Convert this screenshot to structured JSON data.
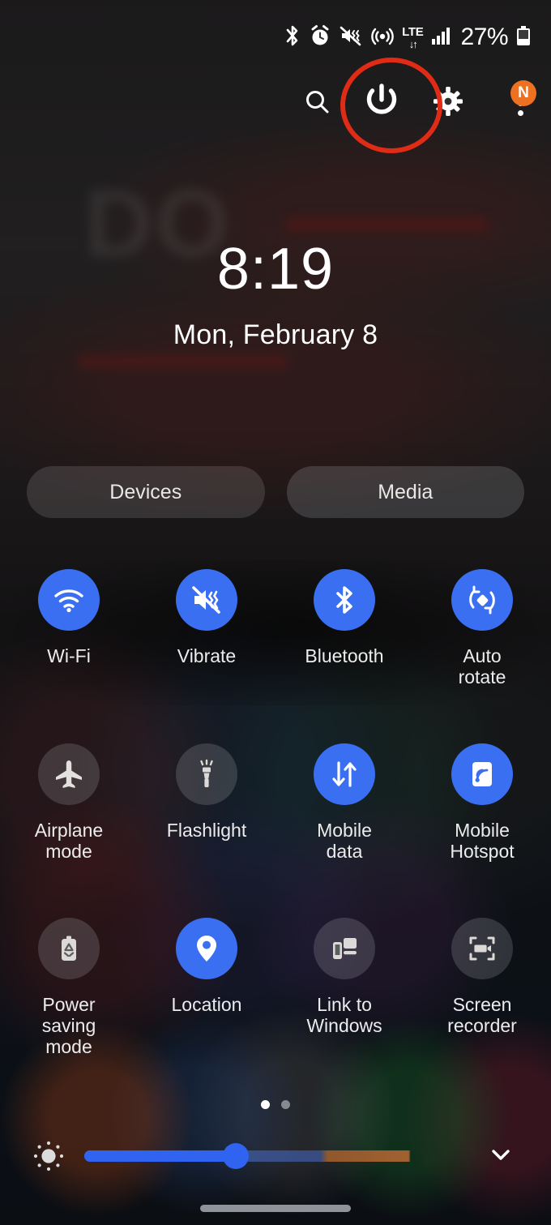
{
  "status_bar": {
    "icons": [
      {
        "name": "bluetooth-status-icon",
        "glyph": "bluetooth"
      },
      {
        "name": "alarm-status-icon",
        "glyph": "alarm"
      },
      {
        "name": "sound-vibrate-status-icon",
        "glyph": "volume-mute-vibrate"
      },
      {
        "name": "hotspot-status-icon",
        "glyph": "hotspot"
      }
    ],
    "network_type": "LTE",
    "network_arrows": "↓↑",
    "signal_icon": "signal-bars-icon",
    "battery_percent": "27%",
    "battery_icon": "battery-icon"
  },
  "header": {
    "search_label": "search-icon",
    "power_label": "power-icon",
    "settings_label": "gear-icon",
    "more_label": "more-options-icon",
    "badge_text": "N",
    "badge_color": "#ED7120",
    "annotation_color": "#E02B16"
  },
  "clock": {
    "time": "8:19",
    "date": "Mon, February 8"
  },
  "wallpaper": {
    "line1": "DO",
    "line2": "    "
  },
  "pills": {
    "devices": "Devices",
    "media": "Media"
  },
  "tiles": [
    {
      "label": "Wi-Fi",
      "icon": "wifi-icon",
      "state": "on",
      "name": "tile-wifi"
    },
    {
      "label": "Vibrate",
      "icon": "vibrate-icon",
      "state": "on",
      "name": "tile-vibrate"
    },
    {
      "label": "Bluetooth",
      "icon": "bluetooth-icon",
      "state": "on",
      "name": "tile-bluetooth"
    },
    {
      "label": "Auto\nrotate",
      "icon": "auto-rotate-icon",
      "state": "on",
      "name": "tile-auto-rotate"
    },
    {
      "label": "Airplane\nmode",
      "icon": "airplane-icon",
      "state": "off",
      "name": "tile-airplane-mode"
    },
    {
      "label": "Flashlight",
      "icon": "flashlight-icon",
      "state": "off",
      "name": "tile-flashlight"
    },
    {
      "label": "Mobile\ndata",
      "icon": "mobile-data-icon",
      "state": "on",
      "name": "tile-mobile-data"
    },
    {
      "label": "Mobile\nHotspot",
      "icon": "hotspot-icon",
      "state": "on",
      "name": "tile-mobile-hotspot"
    },
    {
      "label": "Power saving\nmode",
      "icon": "power-saving-icon",
      "state": "off",
      "name": "tile-power-saving-mode"
    },
    {
      "label": "Location",
      "icon": "location-pin-icon",
      "state": "on",
      "name": "tile-location"
    },
    {
      "label": "Link to\nWindows",
      "icon": "link-to-windows-icon",
      "state": "off",
      "name": "tile-link-to-windows"
    },
    {
      "label": "Screen\nrecorder",
      "icon": "screen-recorder-icon",
      "state": "off",
      "name": "tile-screen-recorder"
    }
  ],
  "pager": {
    "total": 2,
    "active_index": 0
  },
  "brightness": {
    "icon": "brightness-sun-icon",
    "value_percent": 41,
    "expand_icon": "chevron-down-icon"
  },
  "colors": {
    "accent_on": "#3A6FF2",
    "slider": "#2F63F0",
    "tile_off": "rgba(190,195,200,.20)"
  }
}
